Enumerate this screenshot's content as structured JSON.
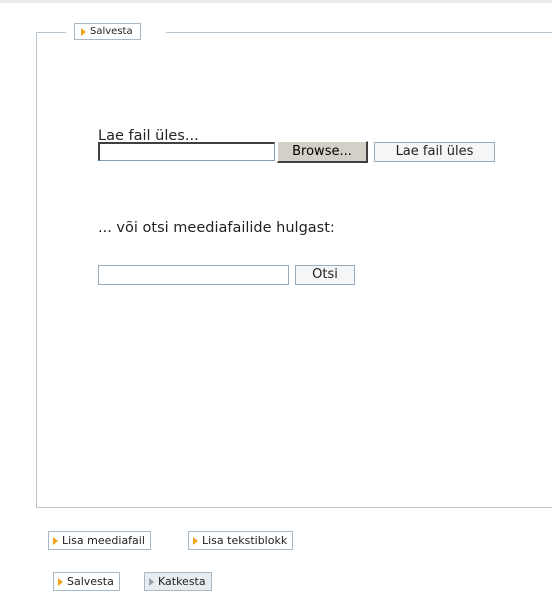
{
  "form": {
    "legend_label": "Salvesta",
    "upload_label": "Lae fail üles...",
    "file_input_value": "",
    "browse_label": "Browse...",
    "upload_button_label": "Lae fail üles",
    "search_label": "... või otsi meediafailide hulgast:",
    "search_input_value": "",
    "search_button_label": "Otsi"
  },
  "actions": {
    "add_media_label": "Lisa meediafail",
    "add_text_block_label": "Lisa tekstiblokk",
    "save_label": "Salvesta",
    "cancel_label": "Katkesta"
  },
  "colors": {
    "accent_arrow": "#f2a31e",
    "border": "#a8b9c5"
  },
  "icons": {
    "arrow": "arrow-right-icon"
  }
}
